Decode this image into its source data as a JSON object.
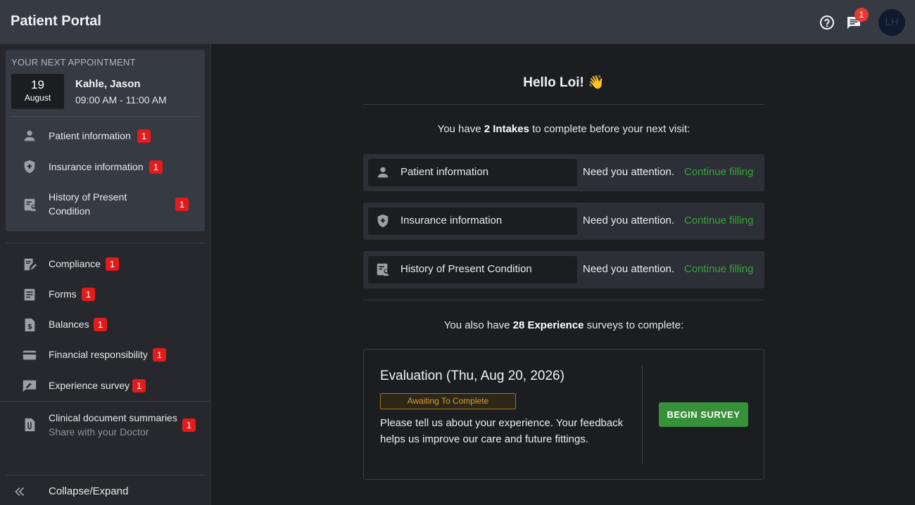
{
  "header": {
    "title": "Patient Portal",
    "notification_count": "1",
    "avatar_initials": "LH"
  },
  "sidebar": {
    "appointment": {
      "heading": "YOUR NEXT APPOINTMENT",
      "day": "19",
      "month": "August",
      "doctor": "Kahle, Jason",
      "time": "09:00 AM - 11:00 AM",
      "items": [
        {
          "label": "Patient information",
          "badge": "1",
          "icon": "person-icon"
        },
        {
          "label": "Insurance information",
          "badge": "1",
          "icon": "shield-icon"
        },
        {
          "label": "History of Present Condition",
          "badge": "1",
          "icon": "clinical-history-icon"
        }
      ]
    },
    "nav": [
      {
        "label": "Compliance",
        "badge": "1",
        "icon": "compliance-icon"
      },
      {
        "label": "Forms",
        "badge": "1",
        "icon": "form-icon"
      },
      {
        "label": "Balances",
        "badge": "1",
        "icon": "dollar-icon"
      },
      {
        "label": "Financial responsibility",
        "badge": "1",
        "icon": "credit-card-icon"
      },
      {
        "label": "Experience survey",
        "badge": "1",
        "icon": "feedback-icon"
      }
    ],
    "clinical": {
      "label": "Clinical document summaries",
      "sublabel": "Share with your Doctor",
      "badge": "1",
      "icon": "attachment-doc-icon"
    },
    "collapse_label": "Collapse/Expand"
  },
  "main": {
    "greeting": "Hello Loi! 👋",
    "intakes_text": {
      "before": "You have ",
      "bold": "2 Intakes",
      "after": " to complete before your next visit:"
    },
    "intakes": [
      {
        "name": "Patient information",
        "status": "Need you attention.",
        "action": "Continue filling",
        "icon": "person-icon"
      },
      {
        "name": "Insurance information",
        "status": "Need you attention.",
        "action": "Continue filling",
        "icon": "shield-icon"
      },
      {
        "name": "History of Present Condition",
        "status": "Need you attention.",
        "action": "Continue filling",
        "icon": "clinical-history-icon"
      }
    ],
    "surveys_text": {
      "before": "You also have ",
      "bold": "28 Experience",
      "after": " surveys to complete:"
    },
    "survey": {
      "title": "Evaluation (Thu, Aug 20, 2026)",
      "status": "Awaiting To Complete",
      "description": "Please tell us about your experience. Your feedback helps us improve our care and future fittings.",
      "button": "BEGIN SURVEY"
    }
  },
  "colors": {
    "accent_green": "#39a23d",
    "badge_red": "#e41b1b",
    "status_amber": "#d89d35"
  }
}
